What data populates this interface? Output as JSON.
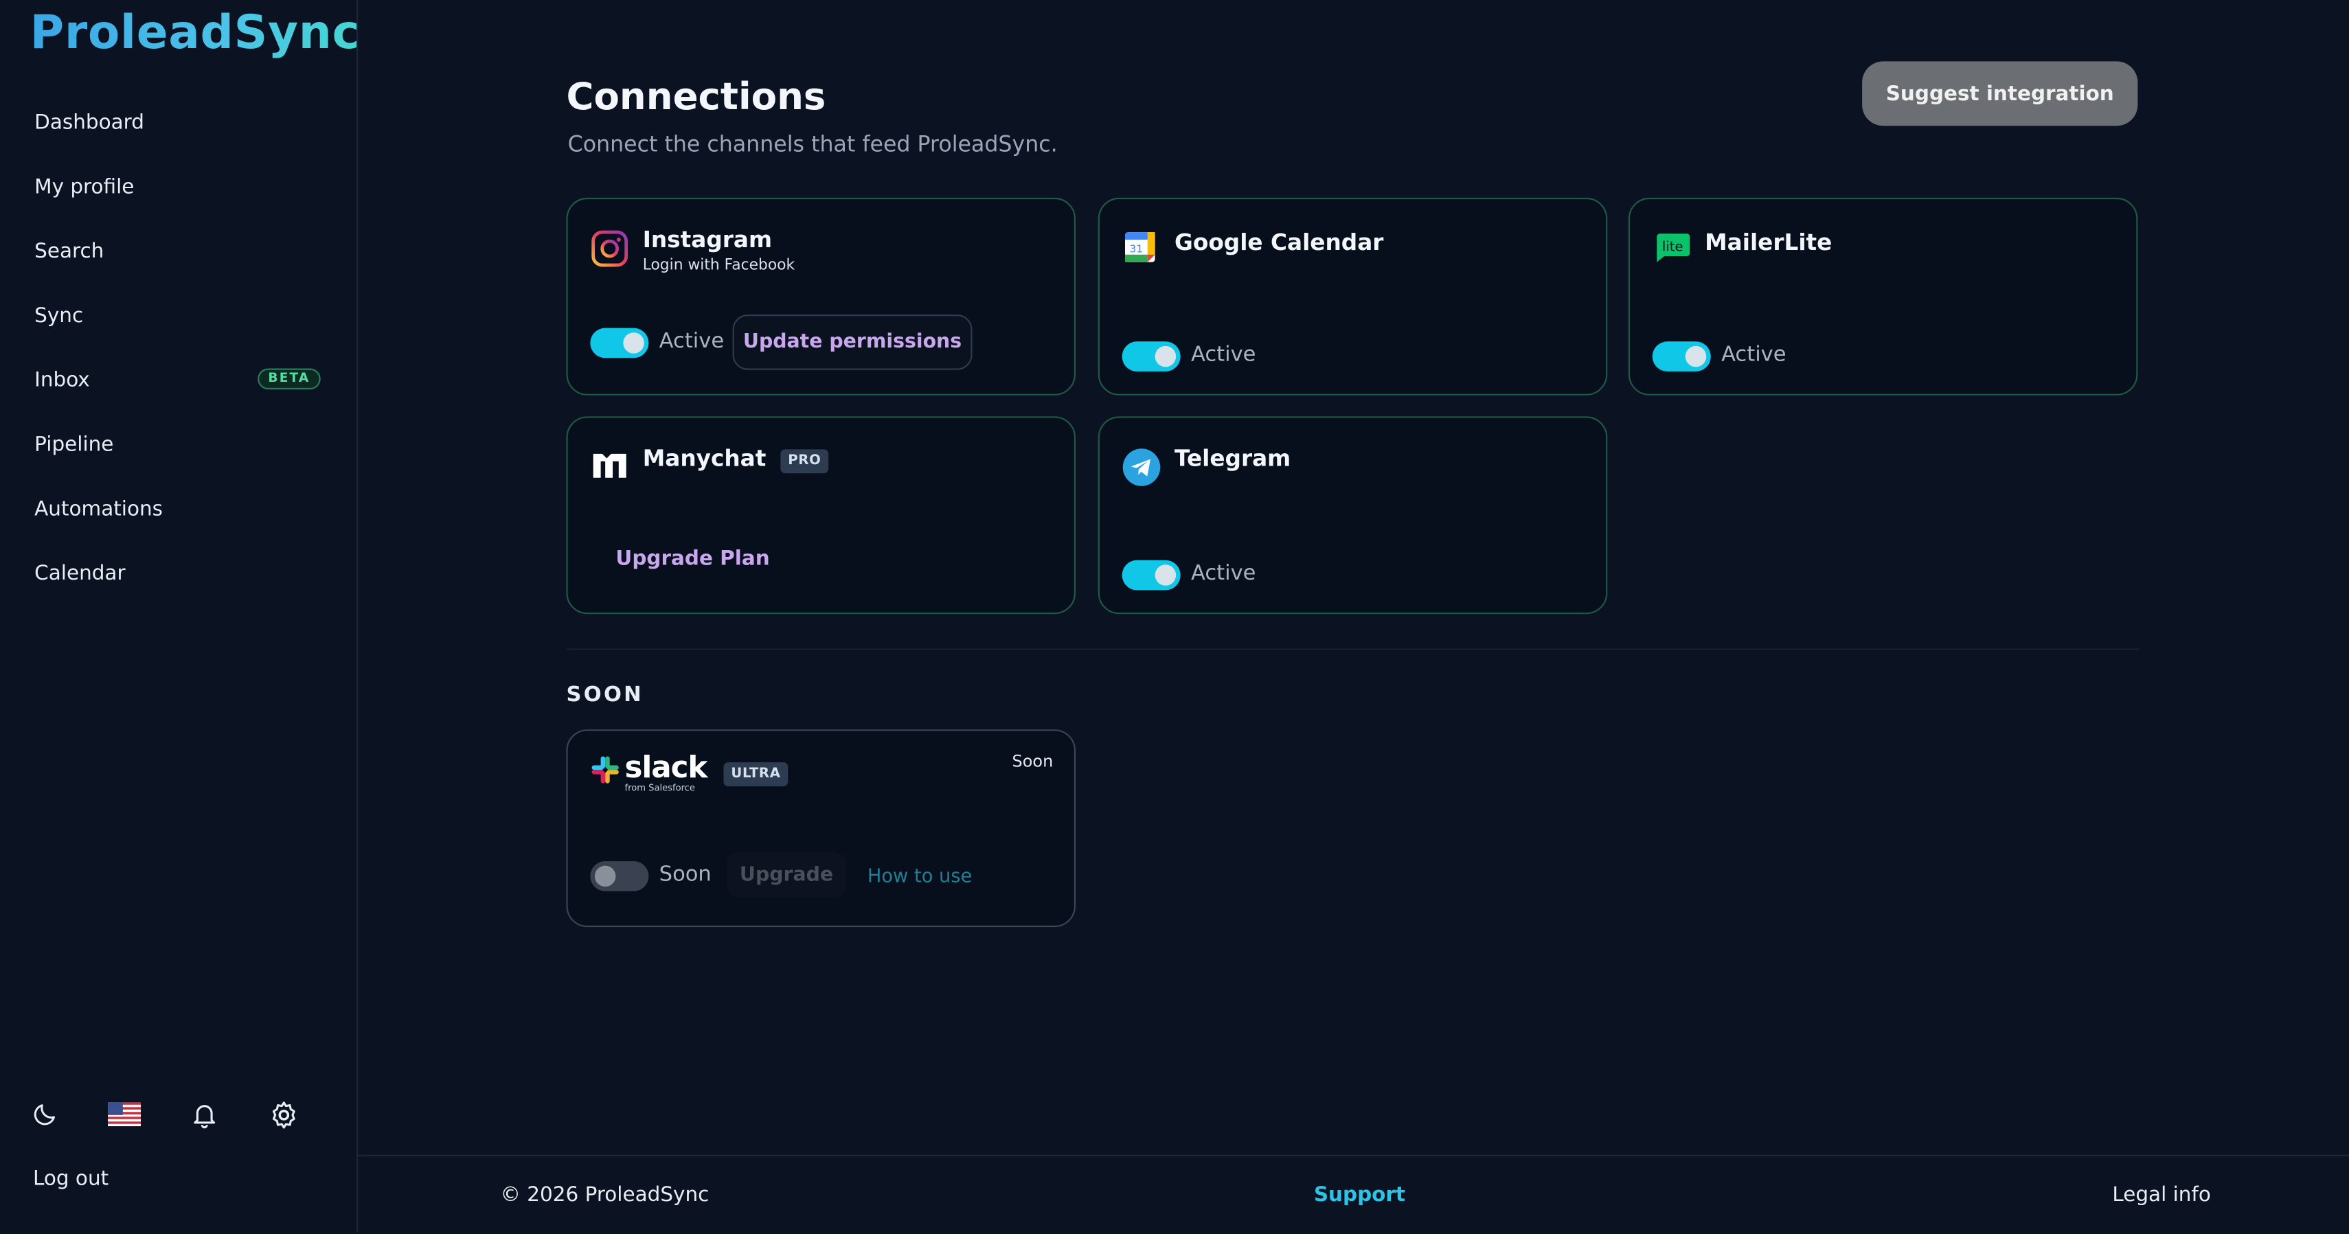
{
  "brand": {
    "logo": "ProleadSync"
  },
  "sidebar": {
    "items": [
      {
        "label": "Dashboard"
      },
      {
        "label": "My profile"
      },
      {
        "label": "Search"
      },
      {
        "label": "Sync"
      },
      {
        "label": "Inbox",
        "badge": "BETA"
      },
      {
        "label": "Pipeline"
      },
      {
        "label": "Automations"
      },
      {
        "label": "Calendar"
      }
    ],
    "tools": [
      "moon-icon",
      "us-flag-icon",
      "bell-icon",
      "gear-icon"
    ],
    "logout": "Log out"
  },
  "header": {
    "title": "Connections",
    "subtitle": "Connect the channels that feed ProleadSync.",
    "suggest_button": "Suggest integration"
  },
  "connections": [
    {
      "name": "Instagram",
      "subtitle": "Login with Facebook",
      "status": "Active",
      "button": "Update permissions",
      "icon": "instagram-icon"
    },
    {
      "name": "Google Calendar",
      "status": "Active",
      "icon": "google-calendar-icon"
    },
    {
      "name": "MailerLite",
      "status": "Active",
      "icon": "mailerlite-icon"
    },
    {
      "name": "Manychat",
      "badge": "PRO",
      "action": "Upgrade Plan",
      "icon": "manychat-icon"
    },
    {
      "name": "Telegram",
      "status": "Active",
      "icon": "telegram-icon"
    }
  ],
  "soon": {
    "heading": "SOON",
    "card": {
      "name": "slack",
      "from": "from Salesforce",
      "badge": "ULTRA",
      "tag": "Soon",
      "status": "Soon",
      "upgrade": "Upgrade",
      "howto": "How to use",
      "icon": "slack-icon"
    }
  },
  "footer": {
    "copyright": "© 2026 ProleadSync",
    "support": "Support",
    "legal": "Legal info"
  },
  "colors": {
    "background": "#0b1221",
    "accent": "#10c7e8",
    "purple_link": "#c9a7ee",
    "card_border": "#1d5a45"
  }
}
